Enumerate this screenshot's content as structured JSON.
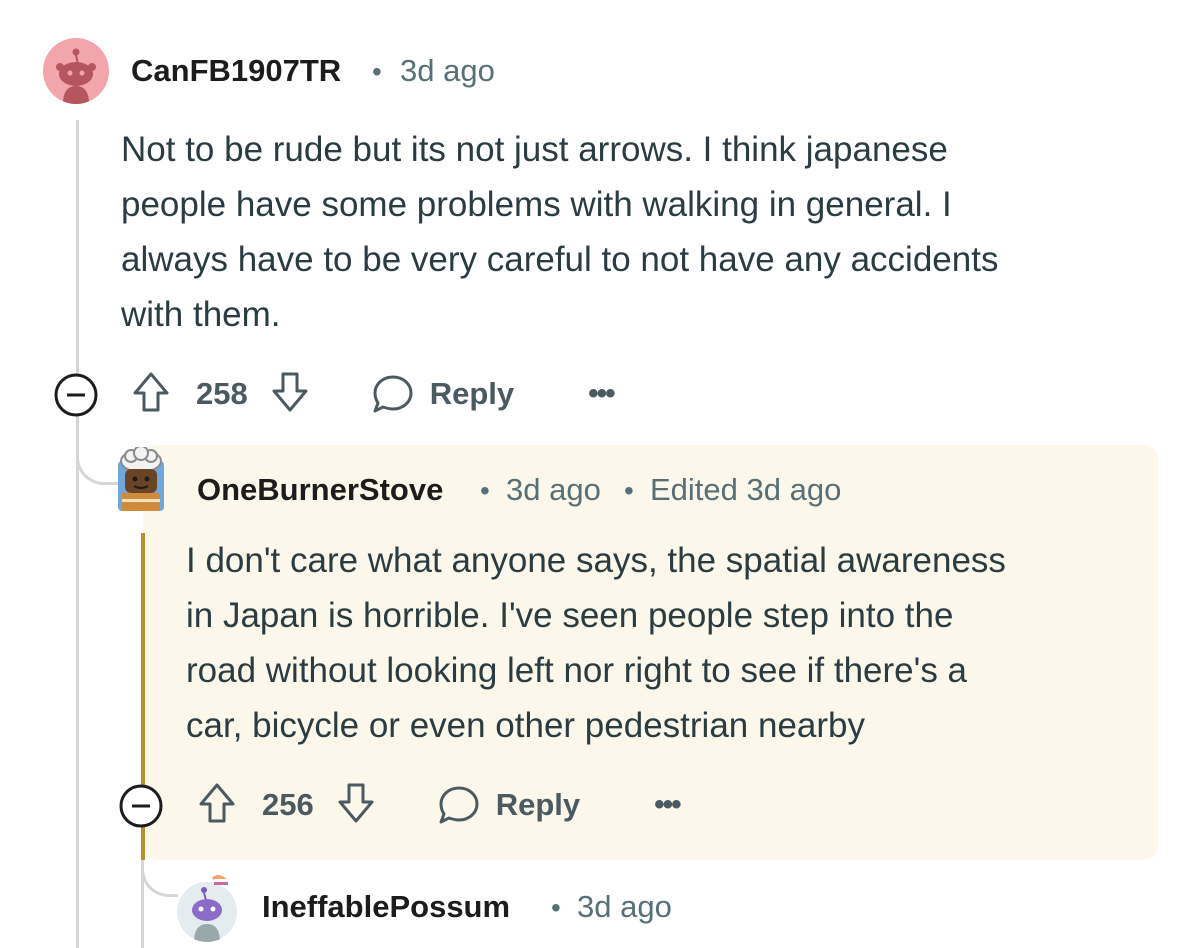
{
  "comments": [
    {
      "username": "CanFB1907TR",
      "time": "3d ago",
      "edited": "",
      "body_lines": [
        "Not to be rude but its not just arrows. I think japanese",
        "people have some problems with walking in general. I",
        "always have to be very careful to not have any accidents",
        "with them."
      ],
      "votes": "258",
      "reply_label": "Reply",
      "more_label": "•••",
      "avatar_icon": "reddit-snoo-avatar-pink"
    },
    {
      "username": "OneBurnerStove",
      "time": "3d ago",
      "edited": "Edited 3d ago",
      "body_lines": [
        "I don't care what anyone says, the spatial awareness",
        "in Japan is horrible. I've seen people step into the",
        "road without looking left nor right to see if there's a",
        "car, bicycle or even other pedestrian nearby"
      ],
      "votes": "256",
      "reply_label": "Reply",
      "more_label": "•••",
      "highlight_color": "#fbf7ea",
      "accent_color": "#b8902f",
      "avatar_icon": "chef-avatar"
    },
    {
      "username": "IneffablePossum",
      "time": "3d ago",
      "avatar_icon": "purple-snoo-avatar"
    }
  ],
  "separator": "•",
  "colors": {
    "meta": "#576f76",
    "thread_line": "#d6d6d6",
    "avatar_pink": "#f2a5ab"
  }
}
